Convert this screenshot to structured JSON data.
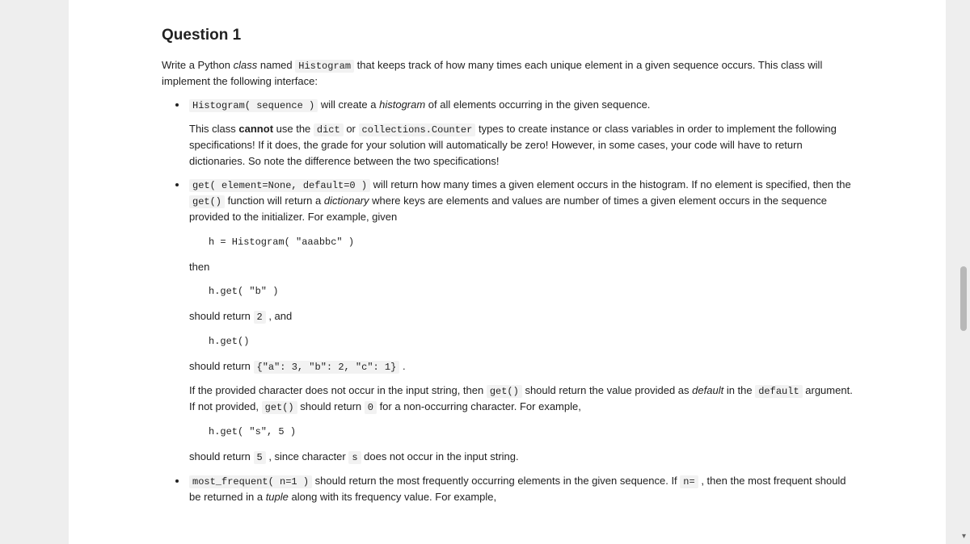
{
  "title": "Question 1",
  "intro_pre": "Write a Python ",
  "intro_class_word": "class",
  "intro_mid": " named ",
  "intro_code_histogram": "Histogram",
  "intro_post": " that keeps track of how many times each unique element in a given sequence occurs. This class will implement the following interface:",
  "bullet1": {
    "code": "Histogram( sequence )",
    "text1": " will create a ",
    "em": "histogram",
    "text2": " of all elements occurring in the given sequence.",
    "para2_a": "This class ",
    "cannot": "cannot",
    "para2_b": " use the ",
    "code_dict": "dict",
    "para2_c": " or ",
    "code_counter": "collections.Counter",
    "para2_d": " types to create instance or class variables in order to implement the following specifications! If it does, the grade for your solution will automatically be zero! However, in some cases, your code will have to return dictionaries. So note the difference between the two specifications!"
  },
  "bullet2": {
    "code_sig": "get( element=None, default=0 )",
    "text_a": " will return how many times a given element occurs in the histogram. If no element is specified, then the ",
    "code_get": "get()",
    "text_b": " function will return a ",
    "em_dict": "dictionary",
    "text_c": " where keys are elements and values are number of times a given element occurs in the sequence provided to the initializer. For example, given",
    "pre1": "h = Histogram( \"aaabbc\" )",
    "then": "then",
    "pre2": "h.get( \"b\" )",
    "ret1_a": "should return ",
    "ret1_code": "2",
    "ret1_b": " , and",
    "pre3": "h.get()",
    "ret2_a": "should return ",
    "ret2_code": "{\"a\": 3, \"b\": 2, \"c\": 1}",
    "ret2_b": " .",
    "para3_a": "If the provided character does not occur in the input string, then ",
    "para3_code1": "get()",
    "para3_b": " should return the value provided as ",
    "para3_em": "default",
    "para3_c": " in the ",
    "para3_code2": "default",
    "para3_d": " argument. If not provided, ",
    "para3_code3": "get()",
    "para3_e": " should return ",
    "para3_code4": "0",
    "para3_f": " for a non-occurring character. For example,",
    "pre4": "h.get( \"s\", 5 )",
    "ret3_a": "should return ",
    "ret3_code1": "5",
    "ret3_b": " , since character ",
    "ret3_code2": "s",
    "ret3_c": " does not occur in the input string."
  },
  "bullet3": {
    "code_sig": "most_frequent( n=1 )",
    "text_a": " should return the most frequently occurring elements in the given sequence. If ",
    "code_n": "n=",
    "text_b": " , then the most frequent should be returned in a ",
    "em_tuple": "tuple",
    "text_c": " along with its frequency value. For example,"
  }
}
